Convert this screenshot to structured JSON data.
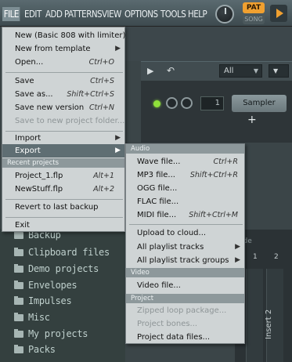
{
  "menubar": {
    "items": [
      "FILE",
      "EDIT",
      "ADD",
      "PATTERNS",
      "VIEW",
      "OPTIONS",
      "TOOLS",
      "HELP"
    ],
    "pat_label": "PAT",
    "song_label": "SONG"
  },
  "channel_rack": {
    "filter_value": "All",
    "channel_number": "1",
    "channel_name": "Sampler",
    "add_label": "+"
  },
  "mixer": {
    "label": "ide",
    "track_numbers": [
      "1",
      "2"
    ],
    "insert_label": "Insert 2"
  },
  "browser": {
    "items": [
      "Backup",
      "Clipboard files",
      "Demo projects",
      "Envelopes",
      "Impulses",
      "Misc",
      "My projects",
      "Packs"
    ]
  },
  "file_menu": {
    "items": [
      {
        "label": "New (Basic 808 with limiter)",
        "shortcut": ""
      },
      {
        "label": "New from template",
        "shortcut": "",
        "submenu": true
      },
      {
        "label": "Open...",
        "shortcut": "Ctrl+O"
      },
      {
        "label": "Save",
        "shortcut": "Ctrl+S"
      },
      {
        "label": "Save as...",
        "shortcut": "Shift+Ctrl+S"
      },
      {
        "label": "Save new version",
        "shortcut": "Ctrl+N"
      },
      {
        "label": "Save to new project folder...",
        "shortcut": "",
        "disabled": true
      },
      {
        "label": "Import",
        "shortcut": "",
        "submenu": true
      },
      {
        "label": "Export",
        "shortcut": "",
        "submenu": true,
        "highlighted": true
      }
    ],
    "recent_header": "Recent projects",
    "recent": [
      {
        "label": "Project_1.flp",
        "shortcut": "Alt+1"
      },
      {
        "label": "NewStuff.flp",
        "shortcut": "Alt+2"
      }
    ],
    "revert_label": "Revert to last backup",
    "exit_label": "Exit"
  },
  "export_menu": {
    "audio_header": "Audio",
    "audio_items": [
      {
        "label": "Wave file...",
        "shortcut": "Ctrl+R"
      },
      {
        "label": "MP3 file...",
        "shortcut": "Shift+Ctrl+R"
      },
      {
        "label": "OGG file...",
        "shortcut": ""
      },
      {
        "label": "FLAC file...",
        "shortcut": ""
      },
      {
        "label": "MIDI file...",
        "shortcut": "Shift+Ctrl+M"
      },
      {
        "label": "Upload to cloud...",
        "shortcut": ""
      },
      {
        "label": "All playlist tracks",
        "shortcut": "",
        "submenu": true
      },
      {
        "label": "All playlist track groups",
        "shortcut": "",
        "submenu": true
      }
    ],
    "video_header": "Video",
    "video_items": [
      {
        "label": "Video file...",
        "shortcut": ""
      }
    ],
    "project_header": "Project",
    "project_items": [
      {
        "label": "Zipped loop package...",
        "shortcut": "",
        "disabled": true
      },
      {
        "label": "Project bones...",
        "shortcut": "",
        "disabled": true
      },
      {
        "label": "Project data files...",
        "shortcut": ""
      }
    ]
  }
}
